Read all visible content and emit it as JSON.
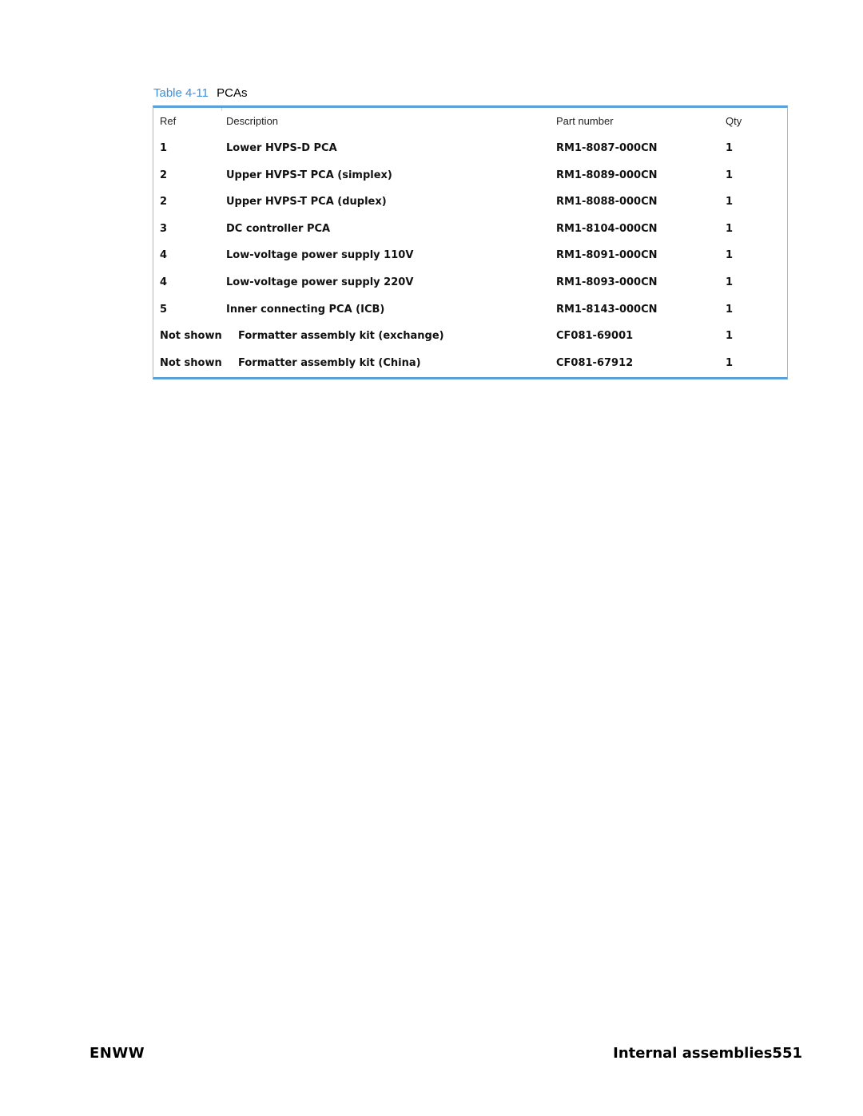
{
  "caption": {
    "label": "Table",
    "number": "4-11",
    "title": "PCAs"
  },
  "table": {
    "headers": {
      "ref": "Ref",
      "description": "Description",
      "part_number": "Part number",
      "qty": "Qty"
    },
    "rows": [
      {
        "ref": "1",
        "description": "Lower HVPS-D PCA",
        "part_number": "RM1-8087-000CN",
        "qty": "1"
      },
      {
        "ref": "2",
        "description": "Upper HVPS-T PCA (simplex)",
        "part_number": "RM1-8089-000CN",
        "qty": "1"
      },
      {
        "ref": "2",
        "description": "Upper HVPS-T PCA (duplex)",
        "part_number": "RM1-8088-000CN",
        "qty": "1"
      },
      {
        "ref": "3",
        "description": "DC controller PCA",
        "part_number": "RM1-8104-000CN",
        "qty": "1"
      },
      {
        "ref": "4",
        "description": "Low-voltage power supply 110V",
        "part_number": "RM1-8091-000CN",
        "qty": "1"
      },
      {
        "ref": "4",
        "description": "Low-voltage power supply 220V",
        "part_number": "RM1-8093-000CN",
        "qty": "1"
      },
      {
        "ref": "5",
        "description": "Inner connecting PCA (ICB)",
        "part_number": "RM1-8143-000CN",
        "qty": "1"
      },
      {
        "ref": "Not shown",
        "description": "Formatter assembly kit (exchange)",
        "part_number": "CF081-69001",
        "qty": "1"
      },
      {
        "ref": "Not shown",
        "description": "Formatter assembly kit (China)",
        "part_number": "CF081-67912",
        "qty": "1"
      }
    ]
  },
  "footer": {
    "left": "ENWW",
    "section": "Internal assemblies",
    "page": "551"
  },
  "colors": {
    "accent": "#3f8fd8",
    "table_rule": "#5b9fd8"
  }
}
